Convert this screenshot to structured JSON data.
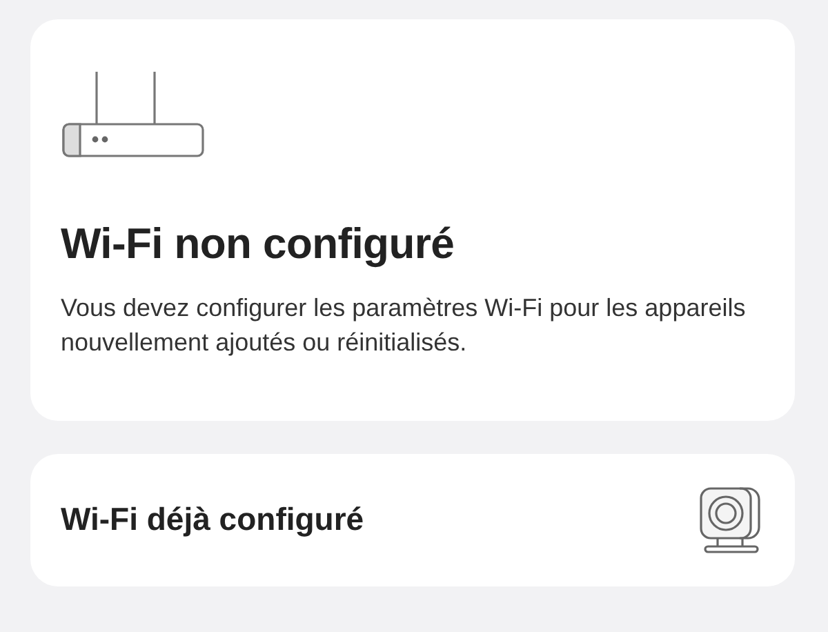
{
  "cards": [
    {
      "kind": "router",
      "title": "Wi-Fi non configuré",
      "description": "Vous devez configurer les paramètres Wi-Fi pour les appareils nouvellement ajoutés ou réinitialisés."
    },
    {
      "kind": "camera",
      "title": "Wi-Fi déjà configuré"
    }
  ]
}
